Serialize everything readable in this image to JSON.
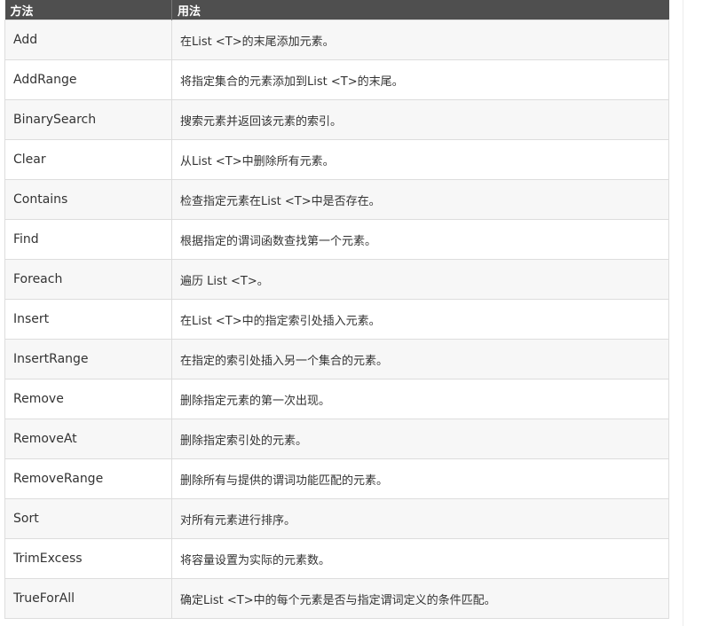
{
  "table": {
    "headers": [
      "方法",
      "用法"
    ],
    "rows": [
      {
        "method": "Add",
        "usage": "在List <T>的末尾添加元素。"
      },
      {
        "method": "AddRange",
        "usage": "将指定集合的元素添加到List <T>的末尾。"
      },
      {
        "method": "BinarySearch",
        "usage": "搜索元素并返回该元素的索引。"
      },
      {
        "method": "Clear",
        "usage": "从List <T>中删除所有元素。"
      },
      {
        "method": "Contains",
        "usage": "检查指定元素在List <T>中是否存在。"
      },
      {
        "method": "Find",
        "usage": "根据指定的谓词函数查找第一个元素。"
      },
      {
        "method": "Foreach",
        "usage": "遍历 List <T>。"
      },
      {
        "method": "Insert",
        "usage": "在List <T>中的指定索引处插入元素。"
      },
      {
        "method": "InsertRange",
        "usage": "在指定的索引处插入另一个集合的元素。"
      },
      {
        "method": "Remove",
        "usage": "删除指定元素的第一次出现。"
      },
      {
        "method": "RemoveAt",
        "usage": "删除指定索引处的元素。"
      },
      {
        "method": "RemoveRange",
        "usage": "删除所有与提供的谓词功能匹配的元素。"
      },
      {
        "method": "Sort",
        "usage": "对所有元素进行排序。"
      },
      {
        "method": "TrimExcess",
        "usage": "将容量设置为实际的元素数。"
      },
      {
        "method": "TrueForAll",
        "usage": "确定List <T>中的每个元素是否与指定谓词定义的条件匹配。"
      }
    ]
  },
  "colors": {
    "header_bg": "#4f4f4f",
    "header_text": "#ffffff",
    "row_odd_bg": "#f7f7f7",
    "row_even_bg": "#ffffff",
    "border": "#dddddd",
    "text": "#333333"
  }
}
